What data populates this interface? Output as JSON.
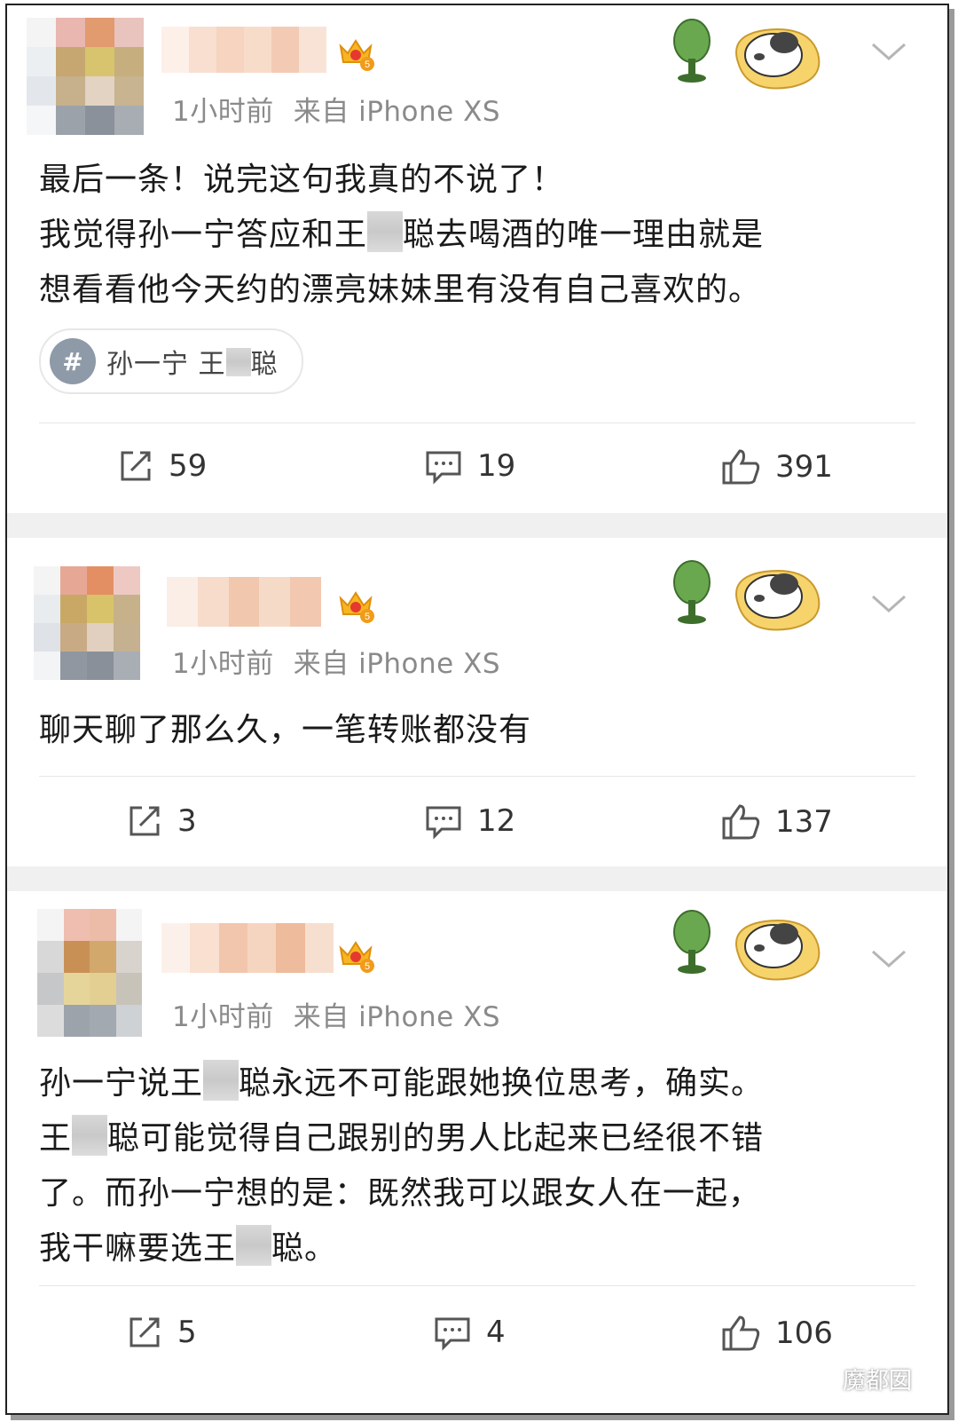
{
  "posts": [
    {
      "time": "1小时前",
      "source": "来自 iPhone XS",
      "lines": [
        "最后一条！说完这句我真的不说了！",
        "我觉得孙一宁答应和王",
        "聪去喝酒的唯一理由就是",
        "想看看他今天约的漂亮妹妹里有没有自己喜欢的。"
      ],
      "topic": {
        "prefix": "孙一宁 王",
        "suffix": "聪"
      },
      "repost": "59",
      "comment": "19",
      "like": "391"
    },
    {
      "time": "1小时前",
      "source": "来自 iPhone XS",
      "lines": [
        "聊天聊了那么久，一笔转账都没有"
      ],
      "repost": "3",
      "comment": "12",
      "like": "137"
    },
    {
      "time": "1小时前",
      "source": "来自 iPhone XS",
      "lines": [
        "孙一宁说王",
        "聪永远不可能跟她换位思考，确实。",
        "王",
        "聪可能觉得自己跟别的男人比起来已经很不错",
        "了。而孙一宁想的是：既然我可以跟女人在一起，",
        "我干嘛要选王",
        "聪。"
      ],
      "repost": "5",
      "comment": "4",
      "like": "106"
    }
  ],
  "icons": {
    "repost": "repost-icon",
    "comment": "comment-icon",
    "like": "thumbs-up-icon",
    "more": "chevron-down-icon",
    "badge": "crown-badge-icon",
    "sticker": "panda-fan-sticker",
    "watermark": "wechat-icon"
  },
  "watermark": {
    "label": "魔都囡"
  },
  "colors": {
    "text": "#1a1a1a",
    "meta": "#8a8a8a",
    "gap": "#f0f0f0"
  }
}
